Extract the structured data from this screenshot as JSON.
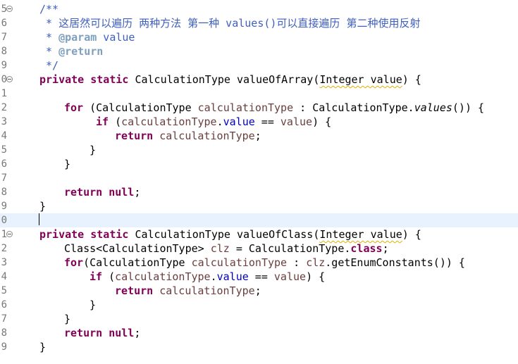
{
  "editor": {
    "colors": {
      "keyword": "#7f0055",
      "comment": "#3f5fbf",
      "javadoc_tag": "#7f9fbf",
      "field": "#0000c0",
      "parameter": "#6a3e3e",
      "current_line": "#e8f2fe",
      "gutter_text": "#787878"
    },
    "lines": [
      {
        "num": "5",
        "fold": true,
        "current": false,
        "indent": 56,
        "tokens": [
          {
            "t": "/**",
            "c": "cm"
          }
        ]
      },
      {
        "num": "6",
        "fold": false,
        "current": false,
        "indent": 56,
        "tokens": [
          {
            "t": " * 这居然可以遍历 两种方法 第一种 values()可以直接遍历 第二种使用反射",
            "c": "cm"
          }
        ]
      },
      {
        "num": "7",
        "fold": false,
        "current": false,
        "indent": 56,
        "tokens": [
          {
            "t": " * ",
            "c": "cm"
          },
          {
            "t": "@param",
            "c": "tag"
          },
          {
            "t": " value",
            "c": "cm"
          }
        ]
      },
      {
        "num": "8",
        "fold": false,
        "current": false,
        "indent": 56,
        "tokens": [
          {
            "t": " * ",
            "c": "cm"
          },
          {
            "t": "@return",
            "c": "tag"
          }
        ]
      },
      {
        "num": "9",
        "fold": false,
        "current": false,
        "indent": 56,
        "tokens": [
          {
            "t": " */",
            "c": "cm"
          }
        ]
      },
      {
        "num": "0",
        "fold": true,
        "current": false,
        "indent": 56,
        "tokens": [
          {
            "t": "private",
            "c": "kw"
          },
          {
            "t": " ",
            "c": "t"
          },
          {
            "t": "static",
            "c": "kw"
          },
          {
            "t": " CalculationType valueOfArray(",
            "c": "t"
          },
          {
            "t": "Integer value",
            "c": "t sq"
          },
          {
            "t": ") {",
            "c": "t"
          }
        ]
      },
      {
        "num": "1",
        "fold": false,
        "current": false,
        "indent": 56,
        "tokens": []
      },
      {
        "num": "2",
        "fold": false,
        "current": false,
        "indent": 91,
        "tokens": [
          {
            "t": "for",
            "c": "kw"
          },
          {
            "t": " (CalculationType ",
            "c": "t"
          },
          {
            "t": "calculationType",
            "c": "par"
          },
          {
            "t": " : CalculationType.",
            "c": "t"
          },
          {
            "t": "values",
            "c": "t it"
          },
          {
            "t": "()) {",
            "c": "t"
          }
        ]
      },
      {
        "num": "3",
        "fold": false,
        "current": false,
        "indent": 136,
        "tokens": [
          {
            "t": "if",
            "c": "kw"
          },
          {
            "t": " (",
            "c": "t"
          },
          {
            "t": "calculationType",
            "c": "par"
          },
          {
            "t": ".",
            "c": "t"
          },
          {
            "t": "value",
            "c": "fld"
          },
          {
            "t": " == ",
            "c": "t"
          },
          {
            "t": "value",
            "c": "par"
          },
          {
            "t": ") {",
            "c": "t"
          }
        ]
      },
      {
        "num": "4",
        "fold": false,
        "current": false,
        "indent": 163,
        "tokens": [
          {
            "t": "return",
            "c": "kw"
          },
          {
            "t": " ",
            "c": "t"
          },
          {
            "t": "calculationType",
            "c": "par"
          },
          {
            "t": ";",
            "c": "t"
          }
        ]
      },
      {
        "num": "5",
        "fold": false,
        "current": false,
        "indent": 127,
        "tokens": [
          {
            "t": "}",
            "c": "t"
          }
        ]
      },
      {
        "num": "6",
        "fold": false,
        "current": false,
        "indent": 91,
        "tokens": [
          {
            "t": "}",
            "c": "t"
          }
        ]
      },
      {
        "num": "7",
        "fold": false,
        "current": false,
        "indent": 56,
        "tokens": []
      },
      {
        "num": "8",
        "fold": false,
        "current": false,
        "indent": 91,
        "tokens": [
          {
            "t": "return",
            "c": "kw"
          },
          {
            "t": " ",
            "c": "t"
          },
          {
            "t": "null",
            "c": "kw"
          },
          {
            "t": ";",
            "c": "t"
          }
        ]
      },
      {
        "num": "9",
        "fold": false,
        "current": false,
        "indent": 56,
        "tokens": [
          {
            "t": "}",
            "c": "t"
          }
        ]
      },
      {
        "num": "0",
        "fold": false,
        "current": true,
        "indent": 56,
        "tokens": []
      },
      {
        "num": "1",
        "fold": true,
        "current": false,
        "indent": 56,
        "tokens": [
          {
            "t": "private",
            "c": "kw"
          },
          {
            "t": " ",
            "c": "t"
          },
          {
            "t": "static",
            "c": "kw"
          },
          {
            "t": " CalculationType valueOfClass(",
            "c": "t"
          },
          {
            "t": "Integer value",
            "c": "t sq"
          },
          {
            "t": ") {",
            "c": "t"
          }
        ]
      },
      {
        "num": "2",
        "fold": false,
        "current": false,
        "indent": 91,
        "tokens": [
          {
            "t": "Class<CalculationType> ",
            "c": "t"
          },
          {
            "t": "clz",
            "c": "par"
          },
          {
            "t": " = CalculationType.",
            "c": "t"
          },
          {
            "t": "class",
            "c": "kw"
          },
          {
            "t": ";",
            "c": "t"
          }
        ]
      },
      {
        "num": "3",
        "fold": false,
        "current": false,
        "indent": 91,
        "tokens": [
          {
            "t": "for",
            "c": "kw"
          },
          {
            "t": "(CalculationType ",
            "c": "t"
          },
          {
            "t": "calculationType",
            "c": "par"
          },
          {
            "t": " : ",
            "c": "t"
          },
          {
            "t": "clz",
            "c": "par"
          },
          {
            "t": ".getEnumConstants()) {",
            "c": "t"
          }
        ]
      },
      {
        "num": "4",
        "fold": false,
        "current": false,
        "indent": 127,
        "tokens": [
          {
            "t": "if",
            "c": "kw"
          },
          {
            "t": " (",
            "c": "t"
          },
          {
            "t": "calculationType",
            "c": "par"
          },
          {
            "t": ".",
            "c": "t"
          },
          {
            "t": "value",
            "c": "fld"
          },
          {
            "t": " == ",
            "c": "t"
          },
          {
            "t": "value",
            "c": "par"
          },
          {
            "t": ") {",
            "c": "t"
          }
        ]
      },
      {
        "num": "5",
        "fold": false,
        "current": false,
        "indent": 163,
        "tokens": [
          {
            "t": "return",
            "c": "kw"
          },
          {
            "t": " ",
            "c": "t"
          },
          {
            "t": "calculationType",
            "c": "par"
          },
          {
            "t": ";",
            "c": "t"
          }
        ]
      },
      {
        "num": "6",
        "fold": false,
        "current": false,
        "indent": 127,
        "tokens": [
          {
            "t": "}",
            "c": "t"
          }
        ]
      },
      {
        "num": "7",
        "fold": false,
        "current": false,
        "indent": 91,
        "tokens": [
          {
            "t": "}",
            "c": "t"
          }
        ]
      },
      {
        "num": "8",
        "fold": false,
        "current": false,
        "indent": 91,
        "tokens": [
          {
            "t": "return",
            "c": "kw"
          },
          {
            "t": " ",
            "c": "t"
          },
          {
            "t": "null",
            "c": "kw"
          },
          {
            "t": ";",
            "c": "t"
          }
        ]
      },
      {
        "num": "9",
        "fold": false,
        "current": false,
        "indent": 56,
        "tokens": [
          {
            "t": "}",
            "c": "t"
          }
        ]
      }
    ]
  }
}
